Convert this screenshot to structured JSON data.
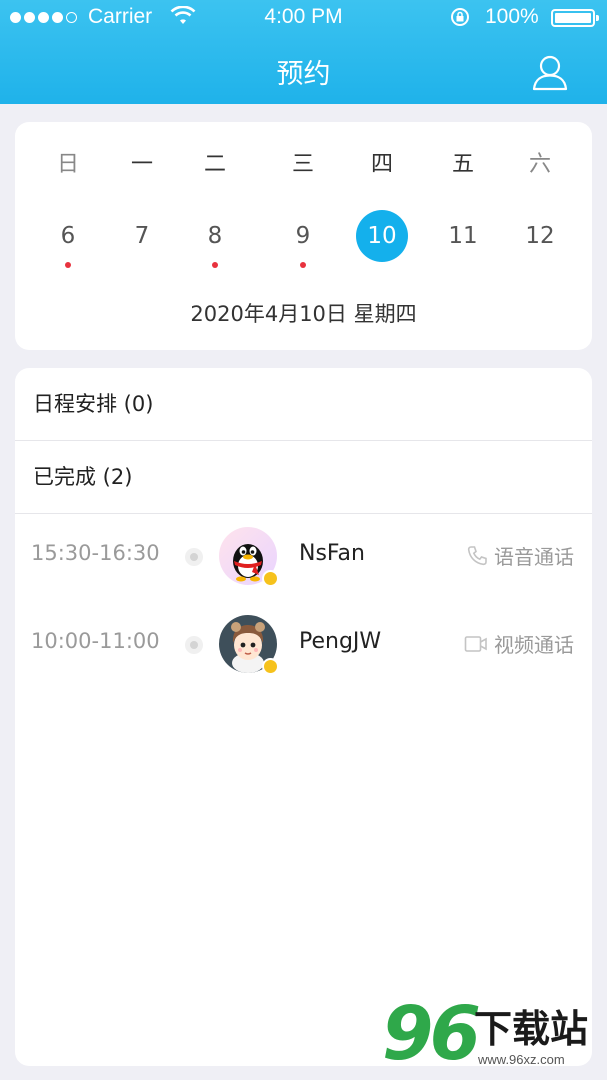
{
  "status_bar": {
    "carrier": "Carrier",
    "time": "4:00 PM",
    "battery": "100%"
  },
  "nav": {
    "title": "预约",
    "profile_icon": "user-icon"
  },
  "calendar": {
    "weekdays": [
      "日",
      "一",
      "二",
      "三",
      "四",
      "五",
      "六"
    ],
    "days": [
      "6",
      "7",
      "8",
      "9",
      "10",
      "11",
      "12"
    ],
    "selected_day": "10",
    "days_with_events": [
      "6",
      "8",
      "9"
    ],
    "full_date": "2020年4月10日  星期四",
    "accent_color": "#14b0ec",
    "event_dot_color": "#e8323e"
  },
  "schedule": {
    "pending_label": "日程安排 (0)",
    "completed_label": "已完成 (2)",
    "appointments": [
      {
        "time": "15:30-16:30",
        "name": "NsFan",
        "call_type": "语音通话",
        "call_icon": "phone-icon",
        "avatar": "qq-penguin-avatar"
      },
      {
        "time": "10:00-11:00",
        "name": "PengJW",
        "call_type": "视频通话",
        "call_icon": "video-icon",
        "avatar": "cartoon-boy-avatar"
      }
    ]
  },
  "watermark": {
    "logo_number": "96",
    "logo_text": "下载站",
    "url": "www.96xz.com"
  }
}
